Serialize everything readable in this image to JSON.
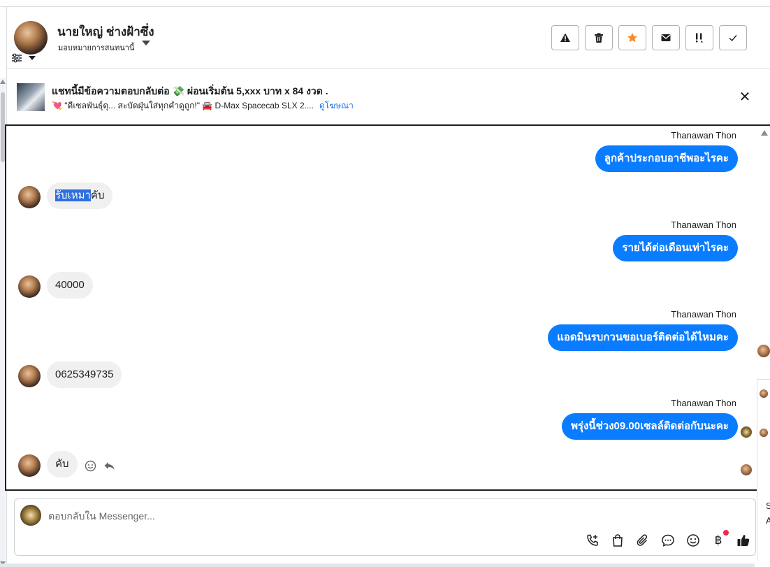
{
  "header": {
    "contact_name": "นายใหญ่ ช่างฝ้าซึ่ง",
    "assign_label": "มอบหมายการสนทนานี้",
    "actions": [
      {
        "name": "spam-button",
        "icon": "warning-icon"
      },
      {
        "name": "delete-button",
        "icon": "trash-icon"
      },
      {
        "name": "star-button",
        "icon": "star-icon"
      },
      {
        "name": "mark-unread-button",
        "icon": "envelope-icon"
      },
      {
        "name": "follow-up-button",
        "icon": "exclaim-icon"
      },
      {
        "name": "mark-done-button",
        "icon": "check-icon"
      }
    ],
    "accent_color": "#f28c28"
  },
  "ad": {
    "title": "แชทนี้มีข้อความตอบกลับต่อ 💸 ผ่อนเริ่มต้น 5,xxx บาท x 84 งวด .",
    "subtitle": "💘 \"ดีเซลพันธุ์ดุ... สะบัดฝุ่นใส่ทุกคำดูถูก!\" 🚘 D-Max Spacecab SLX 2....",
    "link": "ดูโฆษณา"
  },
  "messages": [
    {
      "direction": "out",
      "sender": "Thanawan Thon",
      "text": "ลูกค้าประกอบอาชีพอะไรคะ"
    },
    {
      "direction": "in",
      "highlight": "รับเหมา",
      "text": "คับ"
    },
    {
      "direction": "out",
      "sender": "Thanawan Thon",
      "text": "รายได้ต่อเดือนเท่าไรคะ"
    },
    {
      "direction": "in",
      "text": "40000"
    },
    {
      "direction": "out",
      "sender": "Thanawan Thon",
      "text": "แอดมินรบกวนขอเบอร์ติดต่อได้ไหมคะ"
    },
    {
      "direction": "in",
      "text": "0625349735"
    },
    {
      "direction": "out",
      "sender": "Thanawan Thon",
      "text": "พรุ่งนี้ช่วง09.00เซลล์ติดต่อกับนะคะ"
    },
    {
      "direction": "in",
      "text": "คับ"
    }
  ],
  "composer": {
    "placeholder": "ตอบกลับใน Messenger...",
    "bubble_color": "#0a7cff"
  },
  "edge": {
    "letter1": "S",
    "letter2": "A"
  }
}
